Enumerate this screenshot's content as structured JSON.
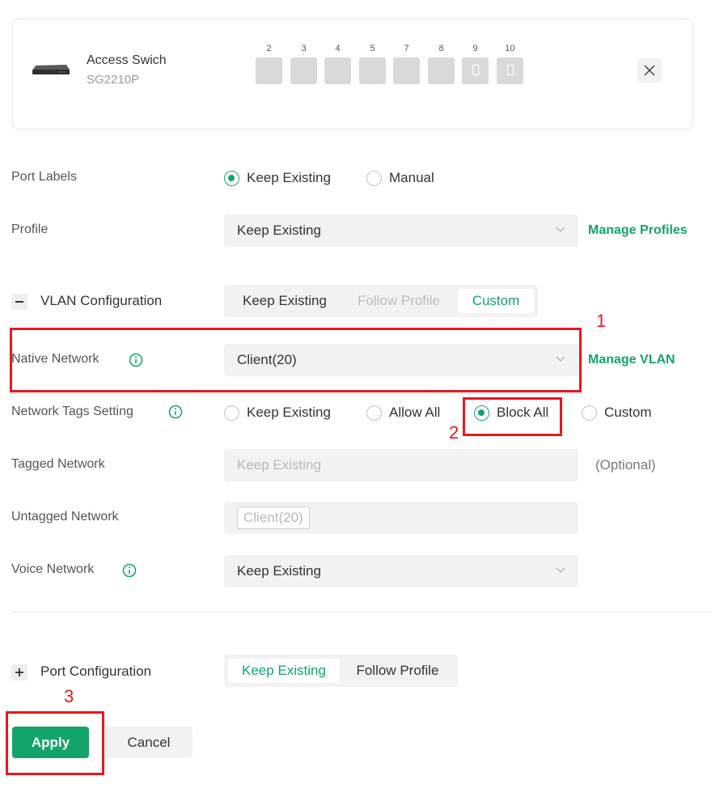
{
  "device": {
    "name": "Access Swich",
    "model": "SG2210P",
    "ports": [
      {
        "num": "2",
        "poe": false
      },
      {
        "num": "3",
        "poe": false
      },
      {
        "num": "4",
        "poe": false
      },
      {
        "num": "5",
        "poe": false
      },
      {
        "num": "7",
        "poe": false
      },
      {
        "num": "8",
        "poe": false
      },
      {
        "num": "9",
        "poe": true
      },
      {
        "num": "10",
        "poe": true
      }
    ]
  },
  "port_labels": {
    "label": "Port Labels",
    "options": [
      "Keep Existing",
      "Manual"
    ],
    "selected": "Keep Existing"
  },
  "profile": {
    "label": "Profile",
    "value": "Keep Existing",
    "manage_link": "Manage Profiles"
  },
  "vlan_config": {
    "title": "VLAN Configuration",
    "toggle": "collapse",
    "options": [
      "Keep Existing",
      "Follow Profile",
      "Custom"
    ],
    "selected": "Custom"
  },
  "native_network": {
    "label": "Native Network",
    "value": "Client(20)",
    "manage_link": "Manage VLAN"
  },
  "network_tags": {
    "label": "Network Tags Setting",
    "options": [
      "Keep Existing",
      "Allow All",
      "Block All",
      "Custom"
    ],
    "selected": "Block All"
  },
  "tagged_network": {
    "label": "Tagged Network",
    "placeholder": "Keep Existing",
    "optional_text": "(Optional)"
  },
  "untagged_network": {
    "label": "Untagged Network",
    "chip": "Client(20)"
  },
  "voice_network": {
    "label": "Voice Network",
    "value": "Keep Existing"
  },
  "port_config": {
    "title": "Port Configuration",
    "toggle": "expand",
    "options": [
      "Keep Existing",
      "Follow Profile"
    ],
    "selected": "Keep Existing"
  },
  "actions": {
    "apply": "Apply",
    "cancel": "Cancel"
  },
  "annotations": [
    "1",
    "2",
    "3"
  ],
  "colors": {
    "accent": "#14a36a",
    "annotation": "#e8171f"
  }
}
